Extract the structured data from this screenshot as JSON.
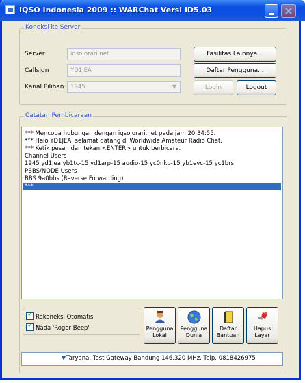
{
  "window": {
    "title": "IQSO Indonesia 2009 :: WARChat Versi ID5.03"
  },
  "server_group": {
    "legend": "Koneksi ke Server",
    "server_label": "Server",
    "server_value": "iqso.orari.net",
    "callsign_label": "Callsign",
    "callsign_value": "YD1JEA",
    "channel_label": "Kanal Pilihan",
    "channel_value": "1945",
    "btn_facilities": "Fasilitas Lainnya...",
    "btn_userlist": "Daftar Pengguna...",
    "btn_login": "Login",
    "btn_logout": "Logout"
  },
  "log_group": {
    "legend": "Catatan Pembicaraan",
    "lines": [
      "*** Mencoba hubungan dengan iqso.orari.net pada jam 20:34:55.",
      "*** Halo YD1JEA, selamat datang di Worldwide Amateur Radio Chat.",
      "*** Ketik pesan dan tekan <ENTER> untuk berbicara.",
      "Channel Users",
      "1945 yd1jea yb1tc-15 yd1arp-15 audio-15 yc0nkb-15 yb1evc-15 yc1brs",
      "PBBS/NODE Users",
      "BBS 9a0bbs (Reverse Forwarding)",
      "***"
    ]
  },
  "options": {
    "auto_reconnect": "Rekoneksi Otomatis",
    "roger_beep": "Nada 'Roger Beep'"
  },
  "tools": [
    {
      "line1": "Pengguna",
      "line2": "Lokal"
    },
    {
      "line1": "Pengguna",
      "line2": "Dunia"
    },
    {
      "line1": "Daftar",
      "line2": "Bantuan"
    },
    {
      "line1": "Hapus",
      "line2": "Layar"
    }
  ],
  "status": {
    "text": "Taryana, Test Gateway Bandung 146.320 MHz, Telp. 0818426975"
  },
  "colors": {
    "titlebar": "#0a4fe0",
    "accent_legend": "#2a5cc8",
    "selection": "#316ac5"
  }
}
